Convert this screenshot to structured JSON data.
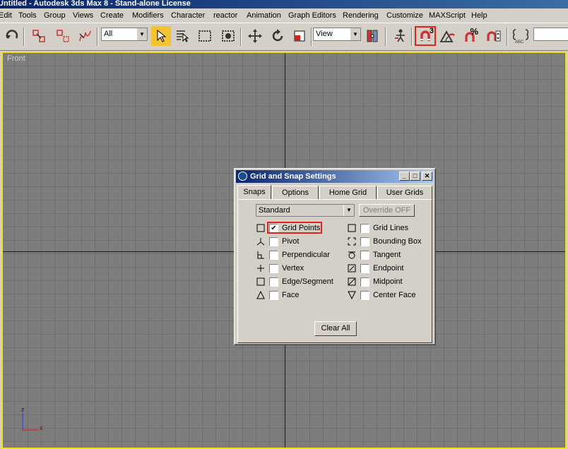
{
  "window": {
    "title": "Untitled - Autodesk 3ds Max 8  - Stand-alone License"
  },
  "menu": [
    "Edit",
    "Tools",
    "Group",
    "Views",
    "Create",
    "Modifiers",
    "Character",
    "reactor",
    "Animation",
    "Graph Editors",
    "Rendering",
    "Customize",
    "MAXScript",
    "Help"
  ],
  "toolbar": {
    "selection_filter": "All",
    "ref_coord": "View",
    "snap_toggle_value": "3",
    "angle_snap_label": "",
    "percent_snap_label": "%"
  },
  "viewport": {
    "label": "Front",
    "axis_z": "z",
    "axis_x": "x"
  },
  "dialog": {
    "title": "Grid and Snap Settings",
    "tabs": [
      "Snaps",
      "Options",
      "Home Grid",
      "User Grids"
    ],
    "selected_tab": "Snaps",
    "snap_type": "Standard",
    "override_label": "Override OFF",
    "snaps_left": [
      {
        "label": "Grid Points",
        "checked": "✔"
      },
      {
        "label": "Pivot",
        "checked": ""
      },
      {
        "label": "Perpendicular",
        "checked": ""
      },
      {
        "label": "Vertex",
        "checked": ""
      },
      {
        "label": "Edge/Segment",
        "checked": ""
      },
      {
        "label": "Face",
        "checked": ""
      }
    ],
    "snaps_right": [
      {
        "label": "Grid Lines",
        "checked": ""
      },
      {
        "label": "Bounding Box",
        "checked": ""
      },
      {
        "label": "Tangent",
        "checked": ""
      },
      {
        "label": "Endpoint",
        "checked": ""
      },
      {
        "label": "Midpoint",
        "checked": ""
      },
      {
        "label": "Center Face",
        "checked": ""
      }
    ],
    "clear_all_label": "Clear All",
    "highlight_color": "#e0241c"
  }
}
